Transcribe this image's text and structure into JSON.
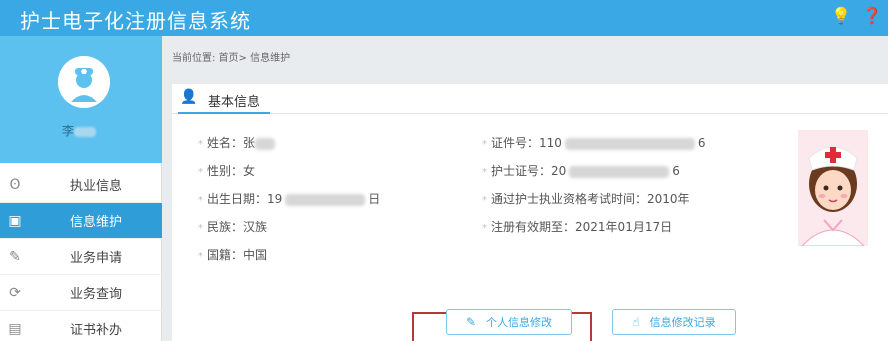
{
  "app": {
    "title": "护士电子化注册信息系统"
  },
  "topbar_icons": {
    "bulb": "💡",
    "extra": "❓"
  },
  "sidebar": {
    "username": "李",
    "items": [
      {
        "label": "执业信息",
        "icon": "ʘ"
      },
      {
        "label": "信息维护",
        "icon": "▣"
      },
      {
        "label": "业务申请",
        "icon": "✎"
      },
      {
        "label": "业务查询",
        "icon": "⟳"
      },
      {
        "label": "证书补办",
        "icon": "▤"
      }
    ]
  },
  "breadcrumb": "当前位置: 首页> 信息维护",
  "panel": {
    "title": "基本信息",
    "left_fields": [
      {
        "label": "姓名：",
        "value_prefix": "张",
        "value_suffix": ""
      },
      {
        "label": "性别：",
        "value_prefix": "女",
        "value_suffix": ""
      },
      {
        "label": "出生日期：",
        "value_prefix": "19",
        "value_suffix": "日"
      },
      {
        "label": "民族：",
        "value_prefix": "汉族",
        "value_suffix": ""
      },
      {
        "label": "国籍：",
        "value_prefix": "中国",
        "value_suffix": ""
      }
    ],
    "right_fields": [
      {
        "label": "证件号：",
        "value_prefix": "110",
        "value_suffix": "6"
      },
      {
        "label": "护士证号：",
        "value_prefix": "20",
        "value_suffix": "6"
      },
      {
        "label": "通过护士执业资格考试时间：",
        "value_prefix": "2010年",
        "value_suffix": ""
      },
      {
        "label": "注册有效期至：",
        "value_prefix": "2021年01月17日",
        "value_suffix": ""
      }
    ]
  },
  "buttons": {
    "edit_label": "个人信息修改",
    "history_label": "信息修改记录"
  }
}
